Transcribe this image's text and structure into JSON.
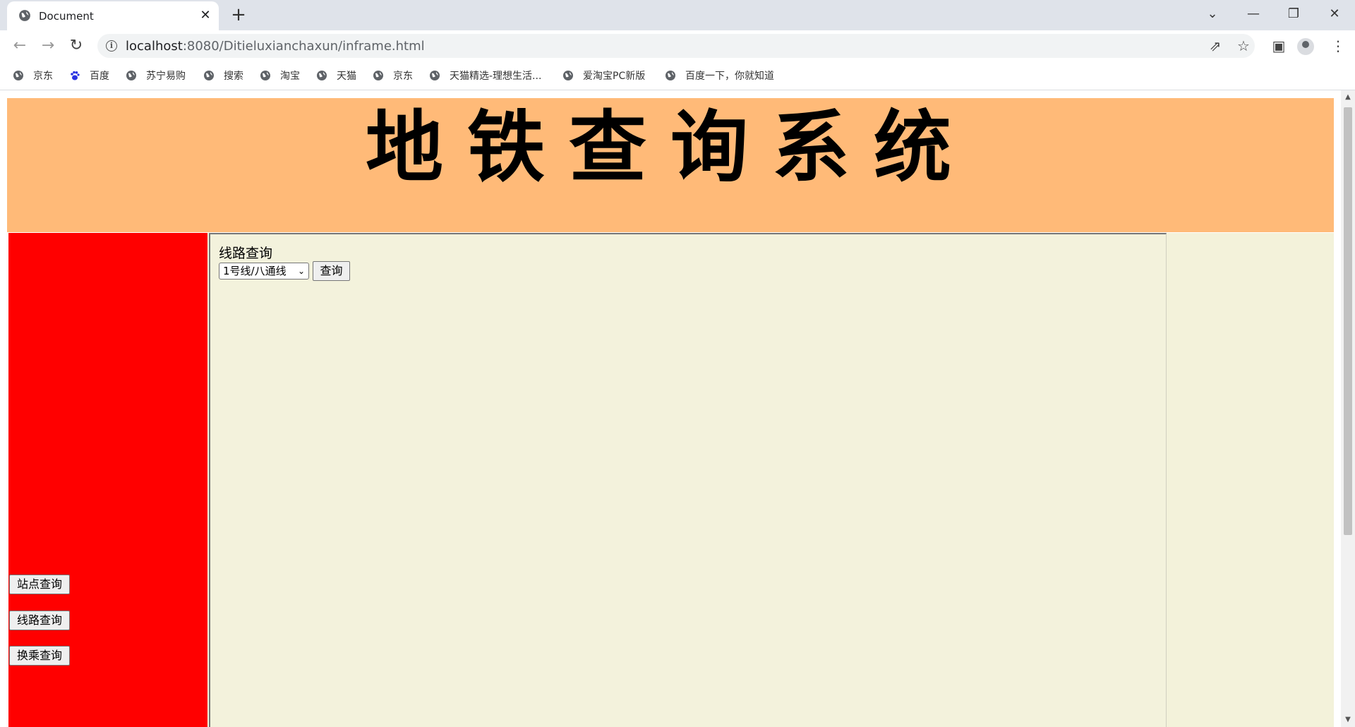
{
  "browser": {
    "tab_title": "Document",
    "tab_close": "✕",
    "new_tab": "+",
    "url_host": "localhost",
    "url_path": ":8080/Ditieluxianchaxun/inframe.html",
    "window_controls": {
      "tab_search": "⌄",
      "minimize": "—",
      "restore": "❐",
      "close": "✕"
    },
    "nav": {
      "back": "←",
      "forward": "→",
      "reload": "↻"
    },
    "toolbar_icons": [
      "share-icon",
      "star-icon",
      "side-panel-icon",
      "profile-icon",
      "menu-icon"
    ]
  },
  "bookmarks": [
    {
      "label": "京东",
      "icon": "globe-icon"
    },
    {
      "label": "百度",
      "icon": "baidu-paw-icon"
    },
    {
      "label": "苏宁易购",
      "icon": "globe-icon"
    },
    {
      "label": "搜索",
      "icon": "globe-icon"
    },
    {
      "label": "淘宝",
      "icon": "globe-icon"
    },
    {
      "label": "天猫",
      "icon": "globe-icon"
    },
    {
      "label": "京东",
      "icon": "globe-icon"
    },
    {
      "label": "天猫精选-理想生活...",
      "icon": "globe-icon"
    },
    {
      "label": "爱淘宝PC新版",
      "icon": "globe-icon"
    },
    {
      "label": "百度一下，你就知道",
      "icon": "globe-icon"
    }
  ],
  "page": {
    "banner_title": "地铁查询系统",
    "sidebar": {
      "buttons": [
        "站点查询",
        "线路查询",
        "换乘查询"
      ]
    },
    "frame": {
      "title": "线路查询",
      "select_value": "1号线/八通线",
      "query_button": "查询"
    }
  },
  "colors": {
    "banner": "#ffba78",
    "sidebar": "#ff0000",
    "content": "#f3f2dc"
  }
}
